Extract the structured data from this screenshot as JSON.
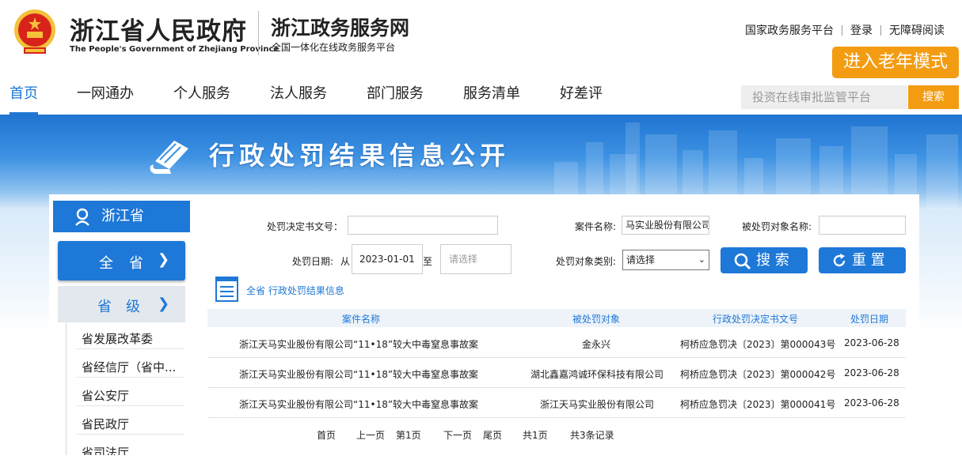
{
  "header": {
    "gov_title": "浙江省人民政府",
    "gov_english": "The People's Government of Zhejiang Province",
    "service_title": "浙江政务服务网",
    "service_subtitle": "全国一体化在线政务服务平台",
    "links": [
      "国家政务服务平台",
      "登录",
      "无障碍阅读"
    ],
    "elder_mode": "进入老年模式"
  },
  "nav": {
    "items": [
      "首页",
      "一网通办",
      "个人服务",
      "法人服务",
      "部门服务",
      "服务清单",
      "好差评"
    ],
    "active": "首页",
    "search_placeholder": "投资在线审批监管平台",
    "search_button": "搜索"
  },
  "banner": {
    "title": "行政处罚结果信息公开"
  },
  "sidebar": {
    "region": "浙江省",
    "all_label": "全省",
    "prov_label": "省级",
    "items": [
      "省发展改革委",
      "省经信厅（省中...",
      "省公安厅",
      "省民政厅",
      "省司法厅"
    ]
  },
  "form": {
    "doc_no_label": "处罚决定书文号：",
    "doc_no_value": "",
    "case_name_label": "案件名称:",
    "case_name_value": "马实业股份有限公司",
    "target_name_label": "被处罚对象名称:",
    "target_name_value": "",
    "date_label": "处罚日期:",
    "date_from_label": "从",
    "date_from_value": "2023-01-01",
    "date_to_label": "至",
    "date_to_placeholder": "请选择",
    "target_type_label": "处罚对象类别:",
    "target_type_value": "请选择",
    "search_button": "搜 索",
    "reset_button": "重 置"
  },
  "breadcrumb": "全省 行政处罚结果信息",
  "table": {
    "columns": [
      "案件名称",
      "被处罚对象",
      "行政处罚决定书文号",
      "处罚日期"
    ],
    "rows": [
      [
        "浙江天马实业股份有限公司“11•18”较大中毒窒息事故案",
        "金永兴",
        "柯桥应急罚决〔2023〕第000043号",
        "2023-06-28"
      ],
      [
        "浙江天马实业股份有限公司“11•18”较大中毒窒息事故案",
        "湖北鑫嘉鸿诚环保科技有限公司",
        "柯桥应急罚决〔2023〕第000042号",
        "2023-06-28"
      ],
      [
        "浙江天马实业股份有限公司“11•18”较大中毒窒息事故案",
        "浙江天马实业股份有限公司",
        "柯桥应急罚决〔2023〕第000041号",
        "2023-06-28"
      ]
    ]
  },
  "pager": {
    "first": "首页",
    "prev": "上一页",
    "current": "第1页",
    "next": "下一页",
    "last": "尾页",
    "total_pages": "共1页",
    "total_records": "共3条记录"
  },
  "colors": {
    "primary": "#1e78d7",
    "accent": "#f39c12",
    "emblem_red": "#d8231a",
    "emblem_gold": "#f3c13a"
  }
}
